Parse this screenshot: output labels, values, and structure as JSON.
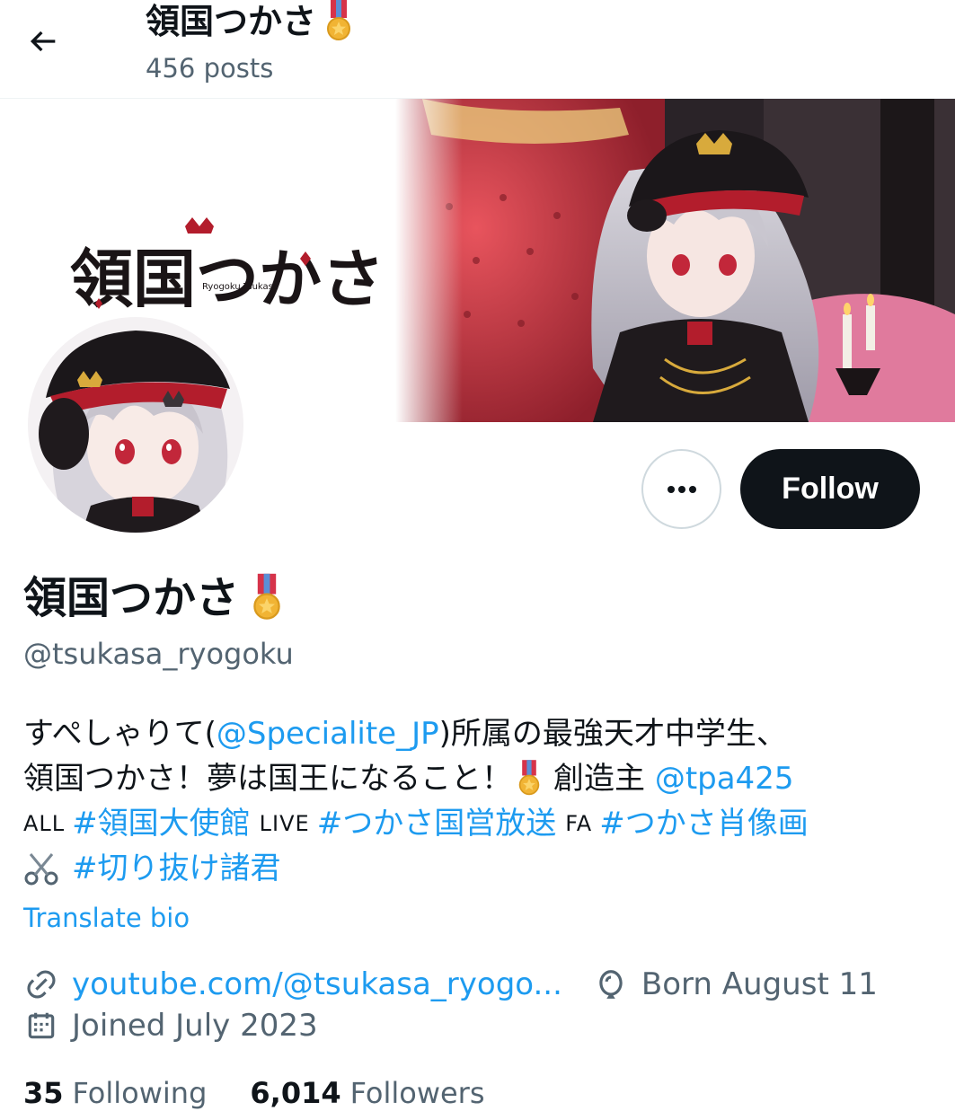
{
  "header": {
    "display_name": "領国つかさ",
    "posts_count": "456 posts",
    "back_icon": "arrow-left-icon"
  },
  "profile": {
    "display_name": "領国つかさ",
    "badge_icon": "medal-icon",
    "handle": "@tsukasa_ryogoku",
    "banner_logo_text": "領国つかさ",
    "banner_logo_sub": "Ryogoku Tsukasa"
  },
  "actions": {
    "more_icon": "ellipsis-icon",
    "follow_label": "Follow"
  },
  "bio": {
    "line1_pre": "すぺしゃりて(",
    "line1_mention": "@Specialite_JP",
    "line1_post": ")所属の最強天才中学生、",
    "line2_pre": "領国つかさ！夢は国王になること！",
    "line2_mid": "創造主 ",
    "line2_mention": "@tpa425",
    "line3_all": "ALL",
    "line3_tag1": "#領国大使館",
    "line3_live": "LIVE",
    "line3_tag2": "#つかさ国営放送",
    "line3_fa": "FA",
    "line3_tag3": "#つかさ肖像画",
    "line4_icon": "scissors-icon",
    "line4_tag": "#切り抜け諸君",
    "translate_label": "Translate bio"
  },
  "meta": {
    "link_icon": "link-icon",
    "link_text": "youtube.com/@tsukasa_ryogo...",
    "birthday_icon": "balloon-icon",
    "birthday_text": "Born August 11",
    "joined_icon": "calendar-icon",
    "joined_text": "Joined July 2023"
  },
  "stats": {
    "following_count": "35",
    "following_label": "Following",
    "followers_count": "6,014",
    "followers_label": "Followers"
  },
  "colors": {
    "accent": "#1d9bf0",
    "text": "#0f1419",
    "secondary": "#536471",
    "button_dark": "#0f1419"
  }
}
